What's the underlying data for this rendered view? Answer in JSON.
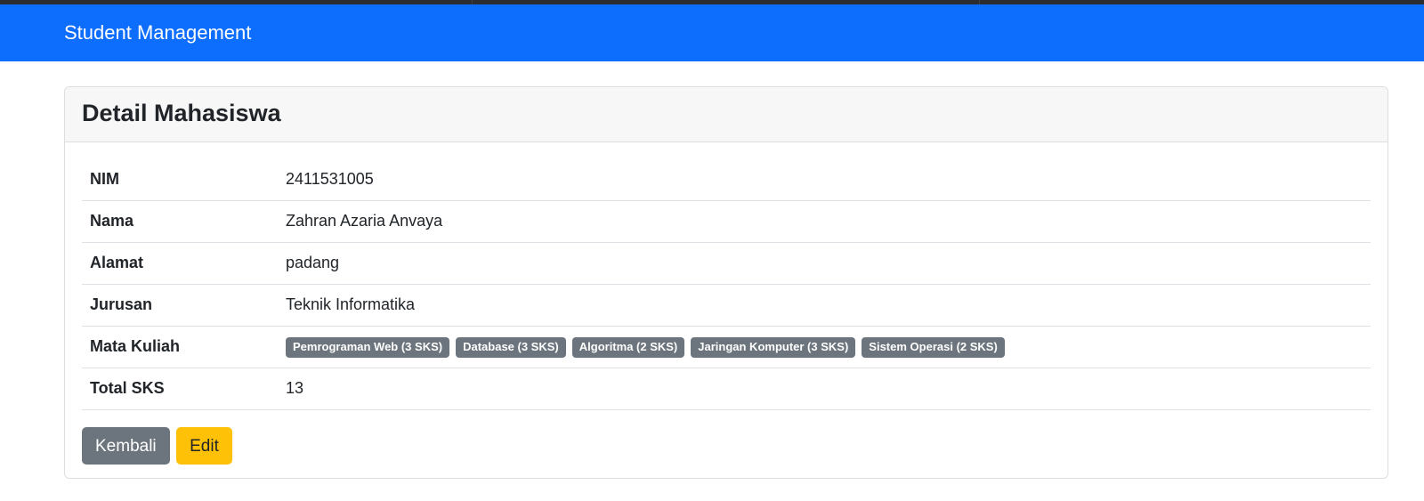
{
  "navbar": {
    "brand": "Student Management"
  },
  "card": {
    "title": "Detail Mahasiswa",
    "rows": {
      "nim": {
        "label": "NIM",
        "value": "2411531005"
      },
      "nama": {
        "label": "Nama",
        "value": "Zahran Azaria Anvaya"
      },
      "alamat": {
        "label": "Alamat",
        "value": "padang"
      },
      "jurusan": {
        "label": "Jurusan",
        "value": "Teknik Informatika"
      },
      "mata_kuliah": {
        "label": "Mata Kuliah",
        "courses": [
          "Pemrograman Web (3 SKS)",
          "Database (3 SKS)",
          "Algoritma (2 SKS)",
          "Jaringan Komputer (3 SKS)",
          "Sistem Operasi (2 SKS)"
        ]
      },
      "total_sks": {
        "label": "Total SKS",
        "value": "13"
      }
    },
    "buttons": {
      "back_label": "Kembali",
      "edit_label": "Edit"
    }
  },
  "colors": {
    "navbar": "#0d6efd",
    "badge": "#6c757d",
    "back_button": "#6c757d",
    "edit_button": "#ffc107"
  }
}
